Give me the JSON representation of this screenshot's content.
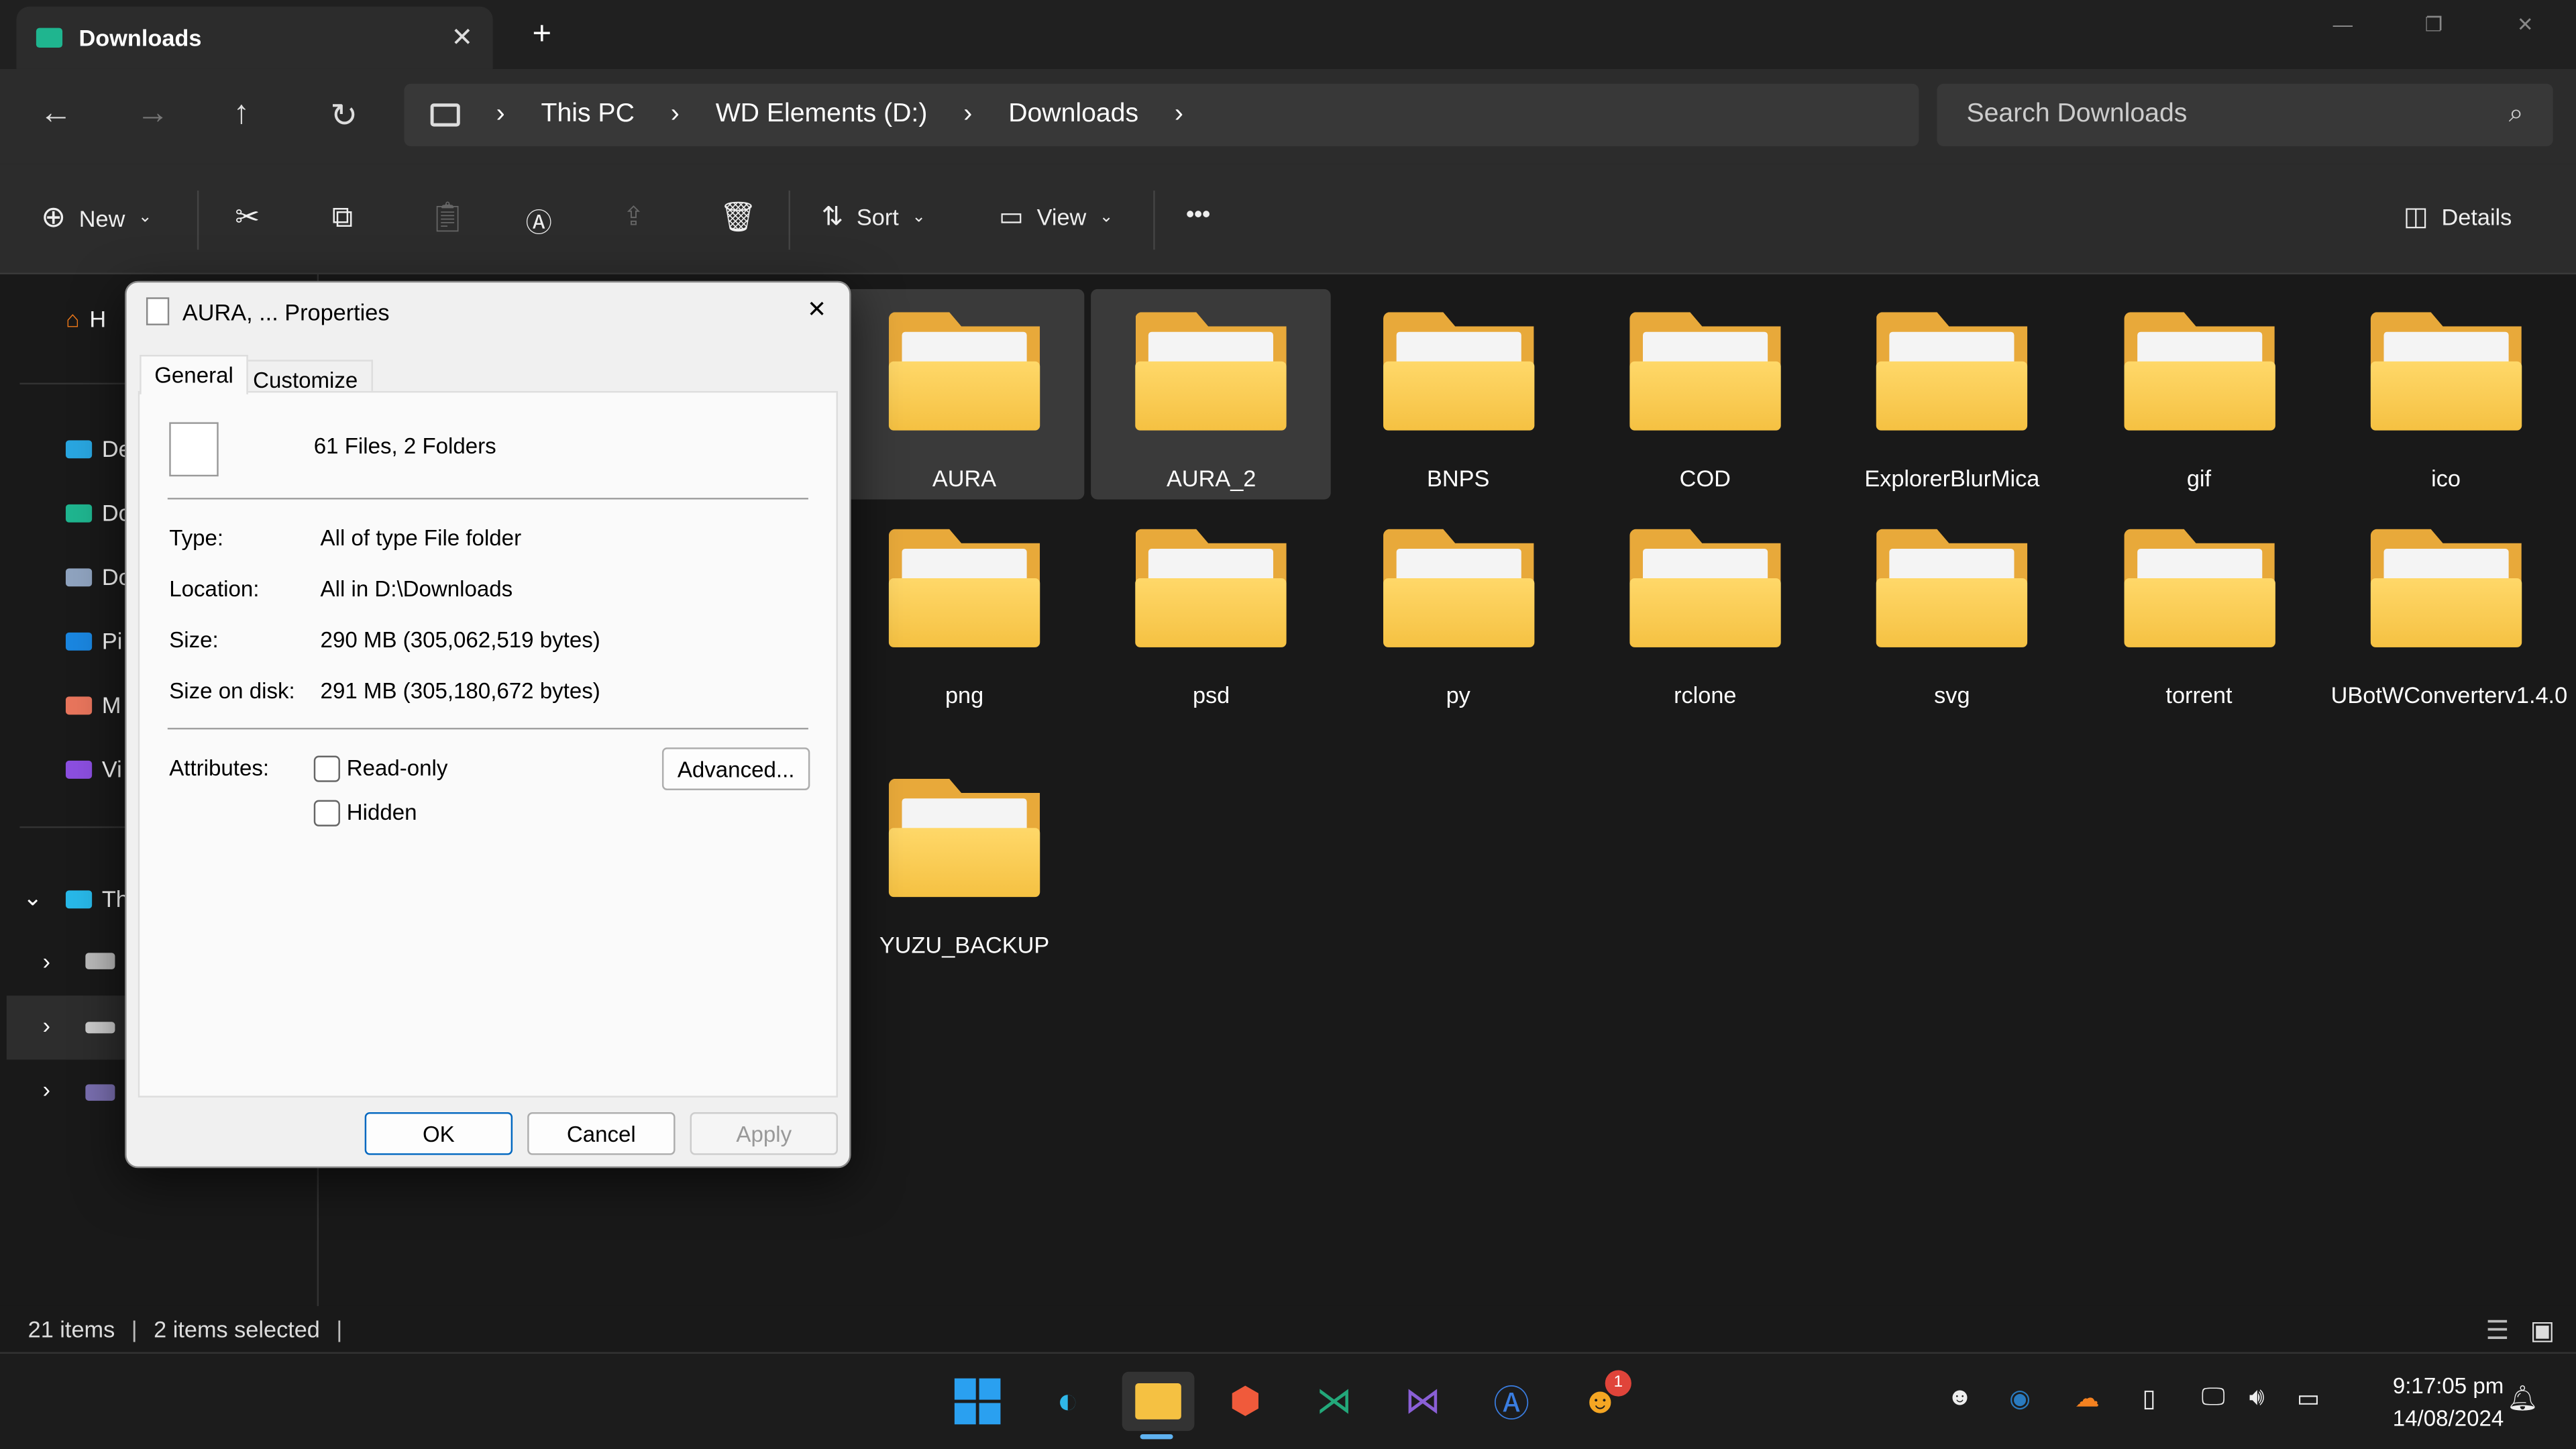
{
  "window": {
    "tab_title": "Downloads",
    "new_tab": "+",
    "close_tab": "✕",
    "controls": [
      "—",
      "❐",
      "✕"
    ]
  },
  "nav": {
    "back": "←",
    "forward": "→",
    "up": "↑",
    "refresh": "↻"
  },
  "breadcrumb": [
    "This PC",
    "WD Elements (D:)",
    "Downloads"
  ],
  "search": {
    "placeholder": "Search Downloads"
  },
  "toolbar": {
    "new": "New",
    "sort": "Sort",
    "view": "View",
    "more": "•••",
    "details": "Details"
  },
  "sidebar": {
    "items": [
      "H",
      "De",
      "Do",
      "Do",
      "Pi",
      "M",
      "Vi"
    ],
    "this_pc": "Th"
  },
  "folders": [
    {
      "name": "AURA",
      "selected": true
    },
    {
      "name": "AURA_2",
      "selected": true
    },
    {
      "name": "BNPS"
    },
    {
      "name": "COD"
    },
    {
      "name": "ExplorerBlurMica"
    },
    {
      "name": "gif"
    },
    {
      "name": "ico"
    },
    {
      "name": "png"
    },
    {
      "name": "psd"
    },
    {
      "name": "py"
    },
    {
      "name": "rclone"
    },
    {
      "name": "svg"
    },
    {
      "name": "torrent"
    },
    {
      "name": "UBotWConverterv1.4.0"
    },
    {
      "name": "YUZU_BACKUP"
    }
  ],
  "status": {
    "items": "21 items",
    "selected": "2 items selected"
  },
  "dialog": {
    "title": "AURA, ... Properties",
    "tabs": [
      "General",
      "Customize"
    ],
    "summary": "61 Files, 2 Folders",
    "type_label": "Type:",
    "type": "All of type File folder",
    "location_label": "Location:",
    "location": "All in D:\\Downloads",
    "size_label": "Size:",
    "size": "290 MB (305,062,519 bytes)",
    "disk_label": "Size on disk:",
    "disk": "291 MB (305,180,672 bytes)",
    "attributes_label": "Attributes:",
    "readonly": "Read-only",
    "hidden": "Hidden",
    "advanced": "Advanced...",
    "ok": "OK",
    "cancel": "Cancel",
    "apply": "Apply"
  },
  "taskbar": {
    "time": "9:17:05 pm",
    "date": "14/08/2024",
    "notification_badge": "1"
  }
}
